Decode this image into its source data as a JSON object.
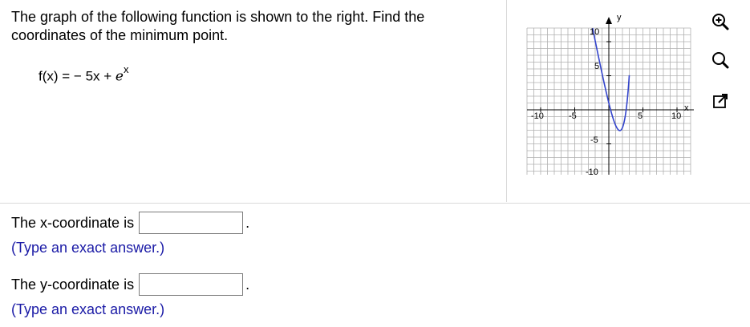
{
  "question": {
    "text": "The graph of the following function is shown to the right. Find the coordinates of the minimum point.",
    "function_lhs": "f(x) = − 5x + ",
    "function_base": "e",
    "function_exponent": "x"
  },
  "graph": {
    "y_axis_label": "y",
    "x_axis_label": "x",
    "tick_labels": {
      "x_neg10": "-10",
      "x_neg5": "-5",
      "x_5": "5",
      "x_10": "10",
      "y_10": "10",
      "y_5": "5",
      "y_neg5": "-5",
      "y_neg10": "-10"
    },
    "curve_color": "#3344cc"
  },
  "tools": [
    "zoom-in-icon",
    "zoom-out-icon",
    "open-external-icon"
  ],
  "answers": [
    {
      "label": "The x-coordinate is",
      "value": "",
      "suffix": ".",
      "hint": "(Type an exact answer.)"
    },
    {
      "label": "The y-coordinate is",
      "value": "",
      "suffix": ".",
      "hint": "(Type an exact answer.)"
    }
  ]
}
